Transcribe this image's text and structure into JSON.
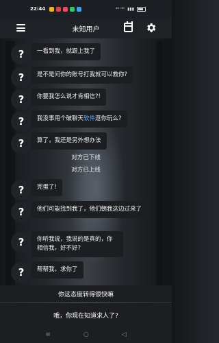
{
  "status_bar": {
    "time": "22:44",
    "indicators": "⁴ᴳ ᴴᴰ"
  },
  "header": {
    "title": "未知用户"
  },
  "icons": {
    "menu": "hamburger-menu-icon",
    "calendar": "calendar-icon",
    "settings": "gear-icon"
  },
  "avatar_symbol": "?",
  "messages": [
    {
      "text": "一看到我，就跟上我了"
    },
    {
      "text": "是不是问你的账号打我就可以救你?"
    },
    {
      "text": "你要我怎么说才肯相信?!"
    },
    {
      "text_before": "我没事用个破聊天",
      "text_highlight": "软件",
      "text_after": "逗你玩么?"
    },
    {
      "text": "算了，我还是另外想办法"
    },
    {
      "text": "完蛋了!"
    },
    {
      "text": "他们可能找到我了，他们朝我这边过来了"
    },
    {
      "text": "你听我说，我说的是真的，你相信我，好不好?"
    },
    {
      "text": "帮帮我，求你了"
    }
  ],
  "system_notices": [
    "对方已下线",
    "对方已上线"
  ],
  "replies": [
    "你这态度转得很快嘛",
    "哦，你现在知道求人了?"
  ],
  "nav": {
    "menu": "≡",
    "home": "○",
    "back": "◁"
  }
}
